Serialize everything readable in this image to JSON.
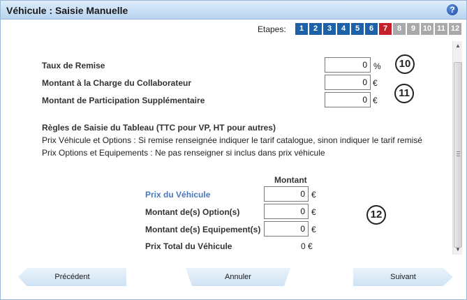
{
  "window": {
    "title": "Véhicule : Saisie Manuelle",
    "help_icon": "question-mark-icon"
  },
  "steps": {
    "label": "Etapes:",
    "items": [
      {
        "n": "1",
        "state": "done"
      },
      {
        "n": "2",
        "state": "done"
      },
      {
        "n": "3",
        "state": "done"
      },
      {
        "n": "4",
        "state": "done"
      },
      {
        "n": "5",
        "state": "done"
      },
      {
        "n": "6",
        "state": "done"
      },
      {
        "n": "7",
        "state": "current"
      },
      {
        "n": "8",
        "state": "todo"
      },
      {
        "n": "9",
        "state": "todo"
      },
      {
        "n": "10",
        "state": "todo"
      },
      {
        "n": "11",
        "state": "todo"
      },
      {
        "n": "12",
        "state": "todo"
      }
    ],
    "colors": {
      "done": "#1d62a8",
      "current": "#c6202a",
      "todo": "#a9a9a9"
    }
  },
  "top_form": {
    "taux_remise": {
      "label": "Taux de Remise",
      "value": "0",
      "unit": "%"
    },
    "montant_collaborateur": {
      "label": "Montant à la Charge du Collaborateur",
      "value": "0",
      "unit": "€"
    },
    "montant_participation": {
      "label": "Montant de Participation Supplémentaire",
      "value": "0",
      "unit": "€"
    }
  },
  "markers": {
    "m10": "10",
    "m11": "11",
    "m12": "12"
  },
  "rules": {
    "title": "Règles de Saisie du Tableau (TTC pour VP, HT pour autres)",
    "line1": "Prix Véhicule et Options : Si remise renseignée indiquer le tarif catalogue, sinon indiquer le tarif remisé",
    "line2": "Prix Options et Equipements : Ne pas renseigner si inclus dans prix véhicule"
  },
  "price_table": {
    "header": "Montant",
    "prix_vehicule": {
      "label": "Prix du Véhicule",
      "value": "0",
      "unit": "€"
    },
    "montant_options": {
      "label": "Montant de(s) Option(s)",
      "value": "0",
      "unit": "€"
    },
    "montant_equipements": {
      "label": "Montant de(s) Equipement(s)",
      "value": "0",
      "unit": "€"
    },
    "prix_total": {
      "label": "Prix Total du Véhicule",
      "value": "0 €"
    }
  },
  "footer": {
    "prev": "Précédent",
    "cancel": "Annuler",
    "next": "Suivant"
  }
}
